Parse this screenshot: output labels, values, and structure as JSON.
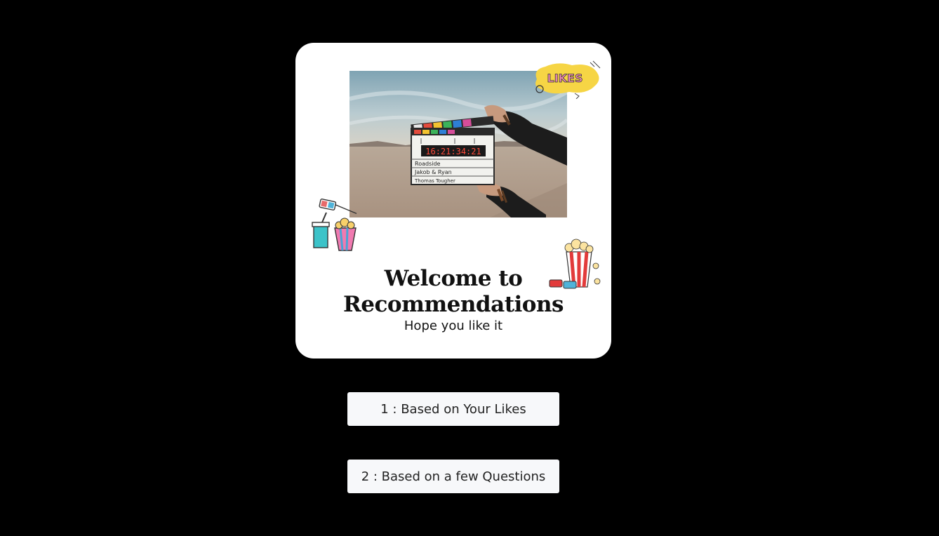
{
  "card": {
    "title_line1": "Welcome to",
    "title_line2": "Recommendations",
    "subtitle": "Hope you like it",
    "likes_sticker_text": "LIKES",
    "clapperboard": {
      "counter": "16:21:34:21",
      "line1": "Roadside",
      "line2": "Jakob & Ryan",
      "line3": "Thomas Tougher"
    }
  },
  "buttons": {
    "likes_label": "1 : Based on Your Likes",
    "questions_label": "2 : Based on a few Questions"
  },
  "colors": {
    "background": "#000000",
    "card": "#ffffff",
    "button": "#f7f8fa"
  }
}
